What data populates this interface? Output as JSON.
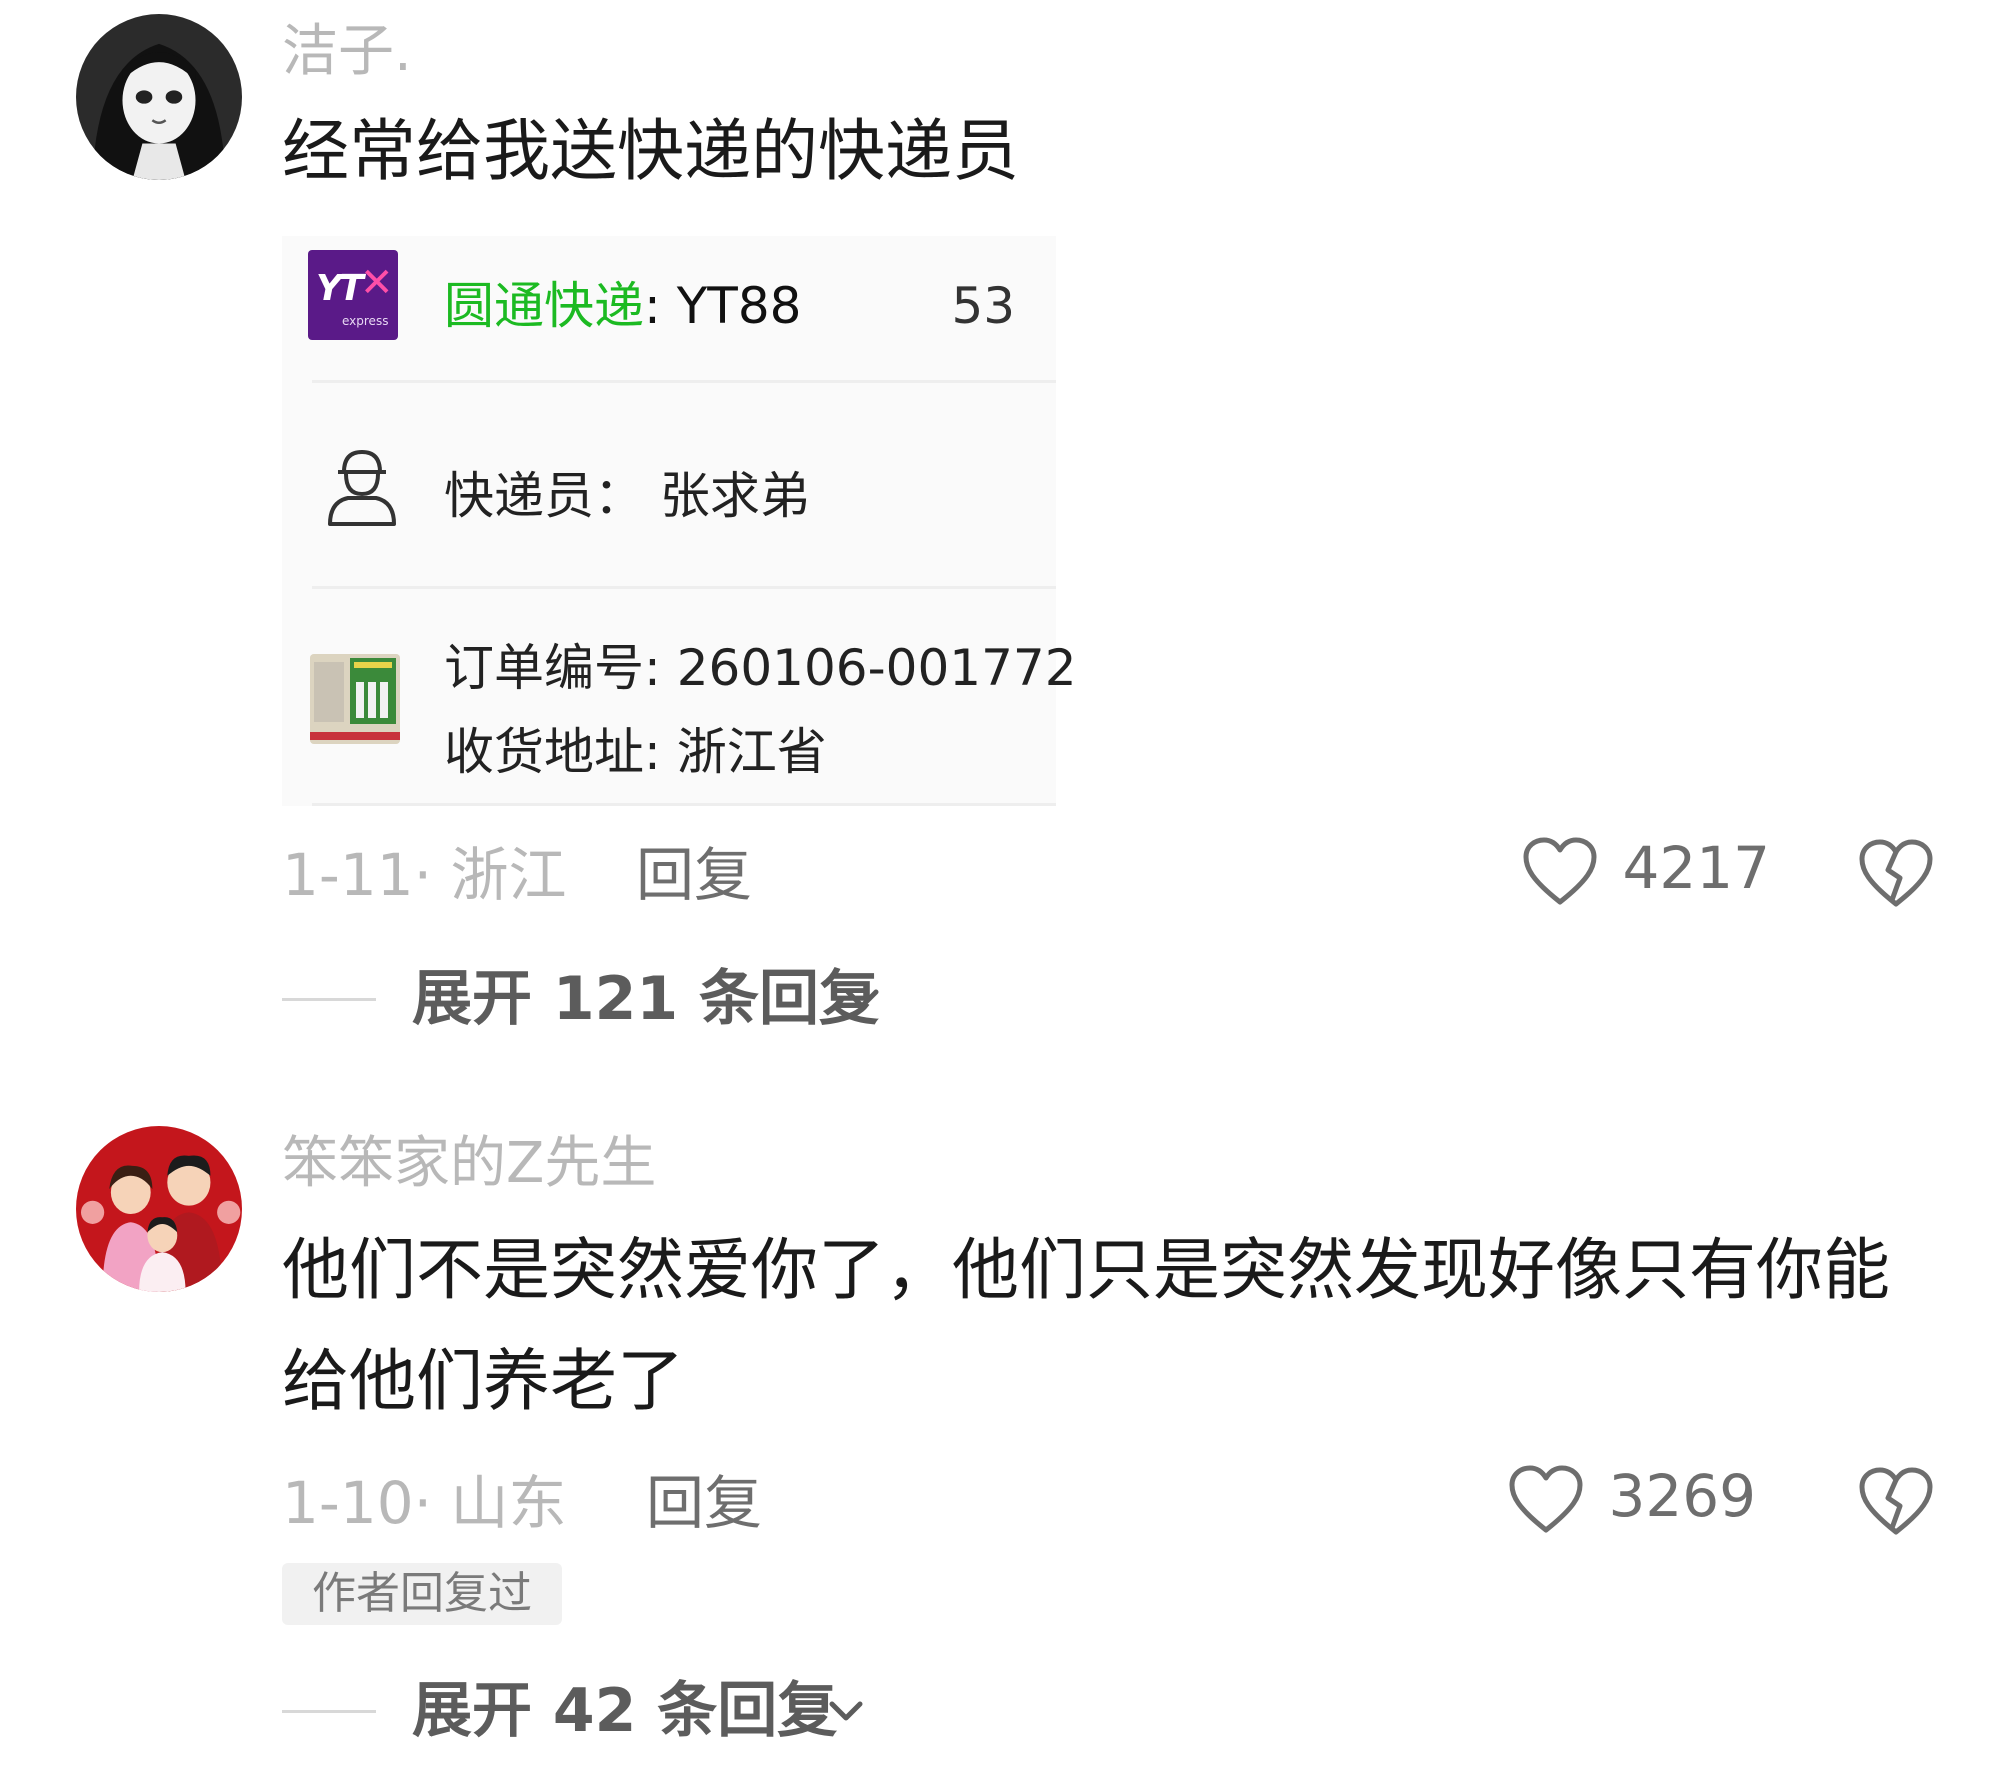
{
  "comments": [
    {
      "username": "洁子.",
      "text": "经常给我送快递的快递员",
      "attachment": {
        "courier_company": "圆通快递",
        "tracking_prefix": ": YT88",
        "tracking_suffix": "53",
        "courier_line": "快递员： 张求弟",
        "order_line": "订单编号: 260106-001772",
        "address_line": "收货地址: 浙江省"
      },
      "date": "1-11",
      "location": "浙江",
      "reply_label": "回复",
      "likes": "4217",
      "expand_label": "展开 121 条回复"
    },
    {
      "username": "笨笨家的Z先生",
      "text": "他们不是突然爱你了，他们只是突然发现好像只有你能给他们养老了",
      "date": "1-10",
      "location": "山东",
      "reply_label": "回复",
      "likes": "3269",
      "badge": "作者回复过",
      "expand_label": "展开 42 条回复"
    }
  ],
  "colors": {
    "meta_gray": "#b8b8b8",
    "action_gray": "#6e6e6e",
    "yto_green": "#1cba22",
    "yto_purple": "#5a1a88"
  }
}
